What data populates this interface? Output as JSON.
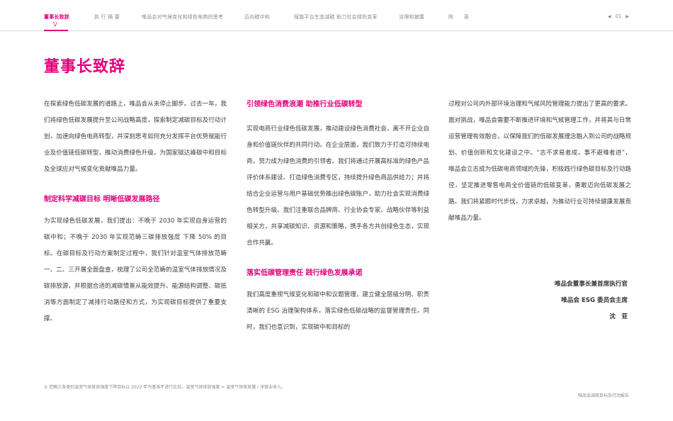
{
  "nav": {
    "items": [
      {
        "label": "董事长致辞",
        "active": true
      },
      {
        "label": "执 行 摘 要",
        "active": false
      },
      {
        "label": "唯品会对气候变化和绿色电商的思考",
        "active": false
      },
      {
        "label": "迈向碳中和",
        "active": false
      },
      {
        "label": "赋能平台生态减碳 助力社会绿色变革",
        "active": false
      },
      {
        "label": "治理和披露",
        "active": false
      },
      {
        "label": "附　　录",
        "active": false
      }
    ],
    "chevron_icon": "chevron-down-icon",
    "page_number": "01",
    "accent_color": "#e2007a"
  },
  "title": "董事长致辞",
  "col1": {
    "p1": "在探索绿色低碳发展的道路上，唯品会从未停止脚步。过去一年，我们将绿色低碳发展提升至公司战略高度，探索制定减碳目标及行动计划，加速向绿色电商转型，并深刻思考如何充分发挥平台优势赋能行业及价值链低碳转型，推动消费绿色升级，为国家碳达峰碳中和目标及全球应对气候变化贡献唯品力量。",
    "h1": "制定科学减碳目标  明晰低碳发展路径",
    "p2": "为实现绿色低碳发展，我们提出：不晚于 2030 年实现自身运营的碳中和；不晚于 2030 年实现范畴三碳排放强度 下降 50% 的目标。在碳目标及行动方案制定过程中，我们针对温室气体排放范畴一、二、三开展全面盘查，梳理了公司全范畴的温室气体排放情况及碳排放源，并根据合适的减碳情景从能效提升、能源结构调整、碳抵消等方面制定了减排行动路径和方式，为实现碳目标提供了重要支撑。"
  },
  "col2": {
    "h1": "引领绿色消费浪潮  助推行业低碳转型",
    "p1": "实现电商行业绿色低碳发展，推动建设绿色消费社会，离不开企业自身和价值链伙伴的共同行动。在企业层面，我们致力于打造可持续电商，努力成为绿色消费的引领者。我们将通过开展高标准的绿色产品评价体系建设、打造绿色消费专区，持续提升绿色商品供给力；并将结合企业运营与用户基础优势推出绿色碳账户，助力社会实现消费绿色转型升级。我们注重联合品牌商、行业协会专家、战略伙伴等利益相关方，共享减碳知识、资源和策略，携手各方共创绿色生态，实现合作共赢。",
    "h2": "落实低碳管理责任  践行绿色发展承诺",
    "p2": "我们高度重视气候变化和碳中和议题管理，建立健全层级分明、职责清晰的 ESG 治理架构体系，落实绿色低碳战略的监督管理责任。同时，我们也意识到，实现碳中和目标的"
  },
  "col3": {
    "p1": "过程对公司内外部环境治理和气候风险管理能力提出了更高的要求。面对挑战，唯品会需要不断推进环境和气候管理工作，并将其与日常运营管理有效融合，以保障我们的低碳发展理念融入到公司的战略规划、价值创新和文化建设之中。“志不求易者成，事不避难者进”，唯品会立志成为低碳电商领域的先锋，积极践行绿色碳目标及行动路径，坚定推进零售电商全价值链的低碳变革，勇敢迈向低碳发展之路。我们将紧跟时代步伐，力求卓越，为推动行业可持续健康发展贡献唯品力量。"
  },
  "signature": {
    "line1": "唯品会董事长兼首席执行官",
    "line2": "唯品会 ESG 委员会主席",
    "line3": "沈　亚"
  },
  "footnote": "① 范畴三各类别温室气体排放强度下降目标以 2022 年为基准年进行比较。温室气体排放强度 = 温室气体排放量 / 净营业收入。",
  "footer": "唯品会减碳目标及行动报告"
}
